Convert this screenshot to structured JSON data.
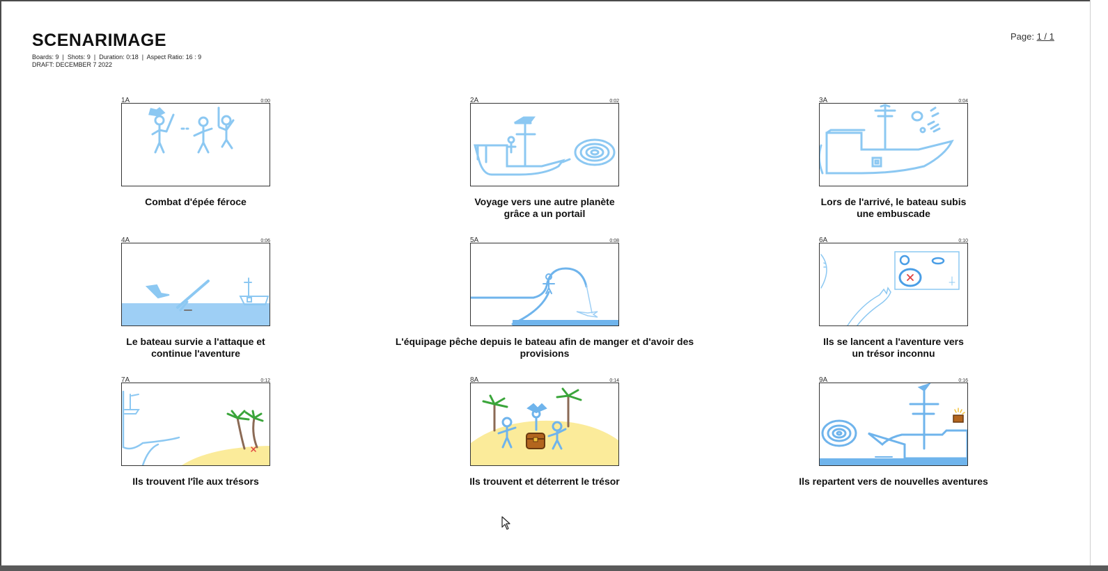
{
  "header": {
    "title": "SCENARIMAGE",
    "meta_line": "Boards: 9  |  Shots: 9  |  Duration: 0:18  |  Aspect Ratio: 16 : 9",
    "draft_line": "DRAFT: DECEMBER 7 2022",
    "page_label": "Page: ",
    "page_value": "1 / 1"
  },
  "boards": [
    {
      "num": "1A",
      "duration": "0:00",
      "caption": "Combat d'épée féroce"
    },
    {
      "num": "2A",
      "duration": "0:02",
      "caption": "Voyage vers une autre planète grâce a un portail"
    },
    {
      "num": "3A",
      "duration": "0:04",
      "caption": "Lors de l'arrivé, le bateau subis une embuscade"
    },
    {
      "num": "4A",
      "duration": "0:06",
      "caption": "Le bateau survie a l'attaque et continue l'aventure"
    },
    {
      "num": "5A",
      "duration": "0:08",
      "caption": "L'équipage pêche depuis le bateau afin de manger et d'avoir des provisions"
    },
    {
      "num": "6A",
      "duration": "0:10",
      "caption": "Ils se lancent a l'aventure vers un trésor inconnu"
    },
    {
      "num": "7A",
      "duration": "0:12",
      "caption": "Ils trouvent l'île aux trésors"
    },
    {
      "num": "8A",
      "duration": "0:14",
      "caption": "Ils trouvent et déterrent le trésor"
    },
    {
      "num": "9A",
      "duration": "0:16",
      "caption": "Ils repartent vers de nouvelles aventures"
    }
  ],
  "colors": {
    "sketch": "#8cc8f2",
    "sea": "#9ecff5",
    "sand": "#fbeb9a",
    "palm": "#3aa53a",
    "trunk": "#8b6a55",
    "mark": "#e04040",
    "chest": "#b3651e"
  },
  "icons": {
    "cursor": "mouse-pointer-icon"
  }
}
